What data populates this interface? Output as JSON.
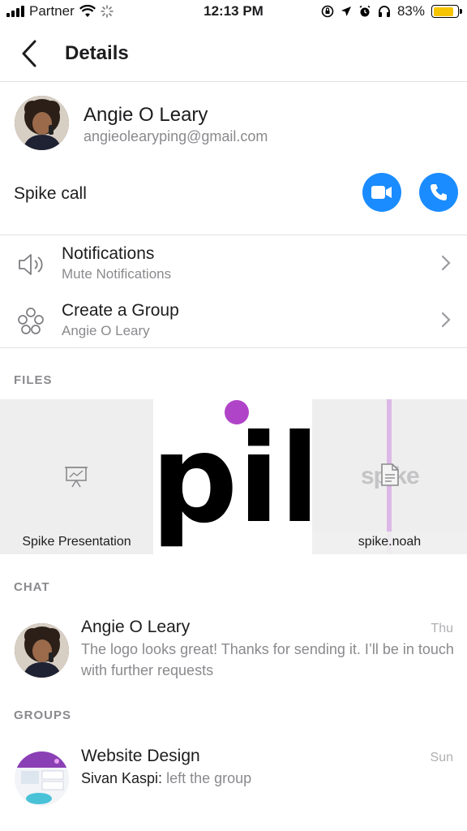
{
  "status_bar": {
    "carrier": "Partner",
    "time": "12:13 PM",
    "battery": "83%",
    "battery_level": 0.83
  },
  "header": {
    "title": "Details"
  },
  "contact": {
    "name": "Angie O Leary",
    "email": "angieolearyping@gmail.com"
  },
  "spike_call": {
    "label": "Spike call"
  },
  "settings": [
    {
      "title": "Notifications",
      "subtitle": "Mute Notifications",
      "icon": "speaker-icon"
    },
    {
      "title": "Create a Group",
      "subtitle": "Angie O Leary",
      "icon": "group-icon"
    }
  ],
  "files": {
    "label": "FILES",
    "items": [
      {
        "name": "Spike Presentation",
        "icon": "presentation-icon"
      },
      {
        "name": "",
        "icon": "spike-logo-image"
      },
      {
        "name": "spike.noah",
        "icon": "document-icon"
      }
    ],
    "logo_text": "pik",
    "watermark_text": "spike"
  },
  "chat": {
    "label": "CHAT",
    "item": {
      "name": "Angie O Leary",
      "time": "Thu",
      "text": "The logo looks great! Thanks for sending it. I’ll be in touch with further requests"
    }
  },
  "groups": {
    "label": "GROUPS",
    "item": {
      "name": "Website Design",
      "time": "Sun",
      "sender": "Sivan Kaspi:",
      "text": "left the group"
    }
  },
  "colors": {
    "accent": "#1a8cff",
    "logo_dot": "#b044c8",
    "battery": "#f7c500"
  }
}
